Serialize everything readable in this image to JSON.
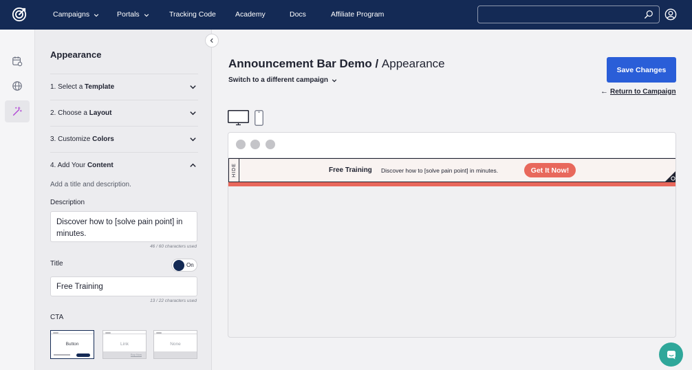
{
  "colors": {
    "nav_bg": "#142a55",
    "primary": "#2a5ed8",
    "accent": "#e8685c",
    "chat": "#2fa79a"
  },
  "topnav": {
    "logo_icon": "brand-logo-icon",
    "items": [
      {
        "label": "Campaigns",
        "has_dropdown": true
      },
      {
        "label": "Portals",
        "has_dropdown": true
      },
      {
        "label": "Tracking Code",
        "has_dropdown": false
      },
      {
        "label": "Academy",
        "has_dropdown": false
      },
      {
        "label": "Docs",
        "has_dropdown": false
      },
      {
        "label": "Affiliate Program",
        "has_dropdown": false
      }
    ],
    "search": {
      "value": "",
      "placeholder": ""
    },
    "profile_icon": "user-circle-icon"
  },
  "rail": {
    "items": [
      {
        "icon": "calendar-settings-icon",
        "active": false
      },
      {
        "icon": "globe-icon",
        "active": false
      },
      {
        "icon": "magic-wand-icon",
        "active": true
      }
    ]
  },
  "panel": {
    "title": "Appearance",
    "steps": [
      {
        "prefix": "1. Select a ",
        "bold": "Template",
        "expanded": false
      },
      {
        "prefix": "2. Choose a ",
        "bold": "Layout",
        "expanded": false
      },
      {
        "prefix": "3. Customize ",
        "bold": "Colors",
        "expanded": false
      },
      {
        "prefix": "4. Add Your ",
        "bold": "Content",
        "expanded": true
      }
    ],
    "content_hint": "Add a title and description.",
    "description": {
      "label": "Description",
      "value": "Discover how to [solve pain point] in minutes.",
      "counter": "46 / 60 characters used"
    },
    "title_field": {
      "label": "Title",
      "toggle_label": "On",
      "toggle_on": true,
      "value": "Free Training",
      "counter": "13 / 22 characters used"
    },
    "cta": {
      "label": "CTA",
      "options": [
        {
          "label": "Button",
          "selected": true
        },
        {
          "label": "Link",
          "selected": false,
          "mini_label": "Buy Now"
        },
        {
          "label": "None",
          "selected": false
        }
      ]
    }
  },
  "main": {
    "campaign_name": "Announcement Bar Demo",
    "separator": " / ",
    "section": "Appearance",
    "switch_link": "Switch to a different campaign",
    "save_label": "Save Changes",
    "return_arrow": "←",
    "return_label": "Return to Campaign",
    "devices": [
      {
        "icon": "desktop-icon",
        "active": true
      },
      {
        "icon": "mobile-icon",
        "active": false
      }
    ]
  },
  "preview": {
    "hide_label": "HIDE",
    "bar_title": "Free Training",
    "bar_description": "Discover how to [solve pain point] in minutes.",
    "cta_label": "Get It Now!"
  },
  "chat": {
    "icon": "chat-bubble-icon"
  }
}
